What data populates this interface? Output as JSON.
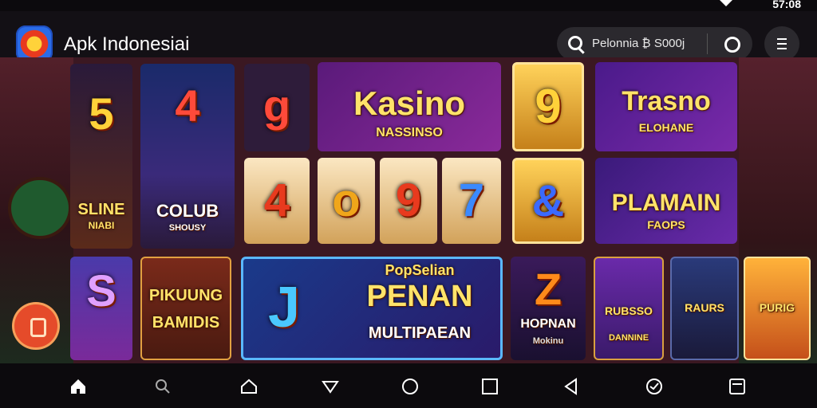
{
  "status": {
    "time": "57:08"
  },
  "app": {
    "title": "Apk Indonesiai"
  },
  "search": {
    "text": "Pelonnia ₿ S000j"
  },
  "tiles": [
    {
      "id": "slot-5",
      "num": "5",
      "label": "SLINE",
      "sub": "NIABI"
    },
    {
      "id": "slot-4-club",
      "num": "4",
      "label": "COLUB",
      "sub": "SHOUSY"
    },
    {
      "id": "slot-g",
      "num": "g",
      "label": "",
      "sub": ""
    },
    {
      "id": "kasino",
      "num": "",
      "label": "Kasino",
      "sub": "NASSINSO"
    },
    {
      "id": "slot-9",
      "num": "9",
      "label": "",
      "sub": ""
    },
    {
      "id": "trasno",
      "num": "",
      "label": "Trasno",
      "sub": "ELOHANE"
    },
    {
      "id": "reel-4",
      "num": "4",
      "label": "",
      "sub": ""
    },
    {
      "id": "reel-0",
      "num": "o",
      "label": "",
      "sub": ""
    },
    {
      "id": "reel-9",
      "num": "9",
      "label": "",
      "sub": ""
    },
    {
      "id": "reel-7",
      "num": "7",
      "label": "",
      "sub": ""
    },
    {
      "id": "slot-amp",
      "num": "&",
      "label": "",
      "sub": ""
    },
    {
      "id": "plamain",
      "num": "",
      "label": "PLAMAIN",
      "sub": "FAOPS"
    },
    {
      "id": "slot-s",
      "num": "S",
      "label": "",
      "sub": ""
    },
    {
      "id": "pikilung",
      "num": "",
      "label": "PIKUUNG",
      "sub": "BAMIDIS"
    },
    {
      "id": "multiplayer",
      "num": "J",
      "label": "PENAN",
      "sub": "MULTIPAEAN",
      "top": "PopSelian"
    },
    {
      "id": "slot-z",
      "num": "Z",
      "label": "HOPNAN",
      "sub": "Mokinu"
    },
    {
      "id": "rubsso",
      "num": "",
      "label": "RUBSSO",
      "sub": "DANNINE"
    },
    {
      "id": "raurs",
      "num": "",
      "label": "RAURS",
      "sub": ""
    },
    {
      "id": "purig",
      "num": "",
      "label": "PURIG",
      "sub": ""
    }
  ],
  "nav": [
    "home-icon",
    "search-icon",
    "house-outline-icon",
    "down-triangle-icon",
    "circle-icon",
    "square-icon",
    "back-icon",
    "chat-icon",
    "recent-icon"
  ]
}
